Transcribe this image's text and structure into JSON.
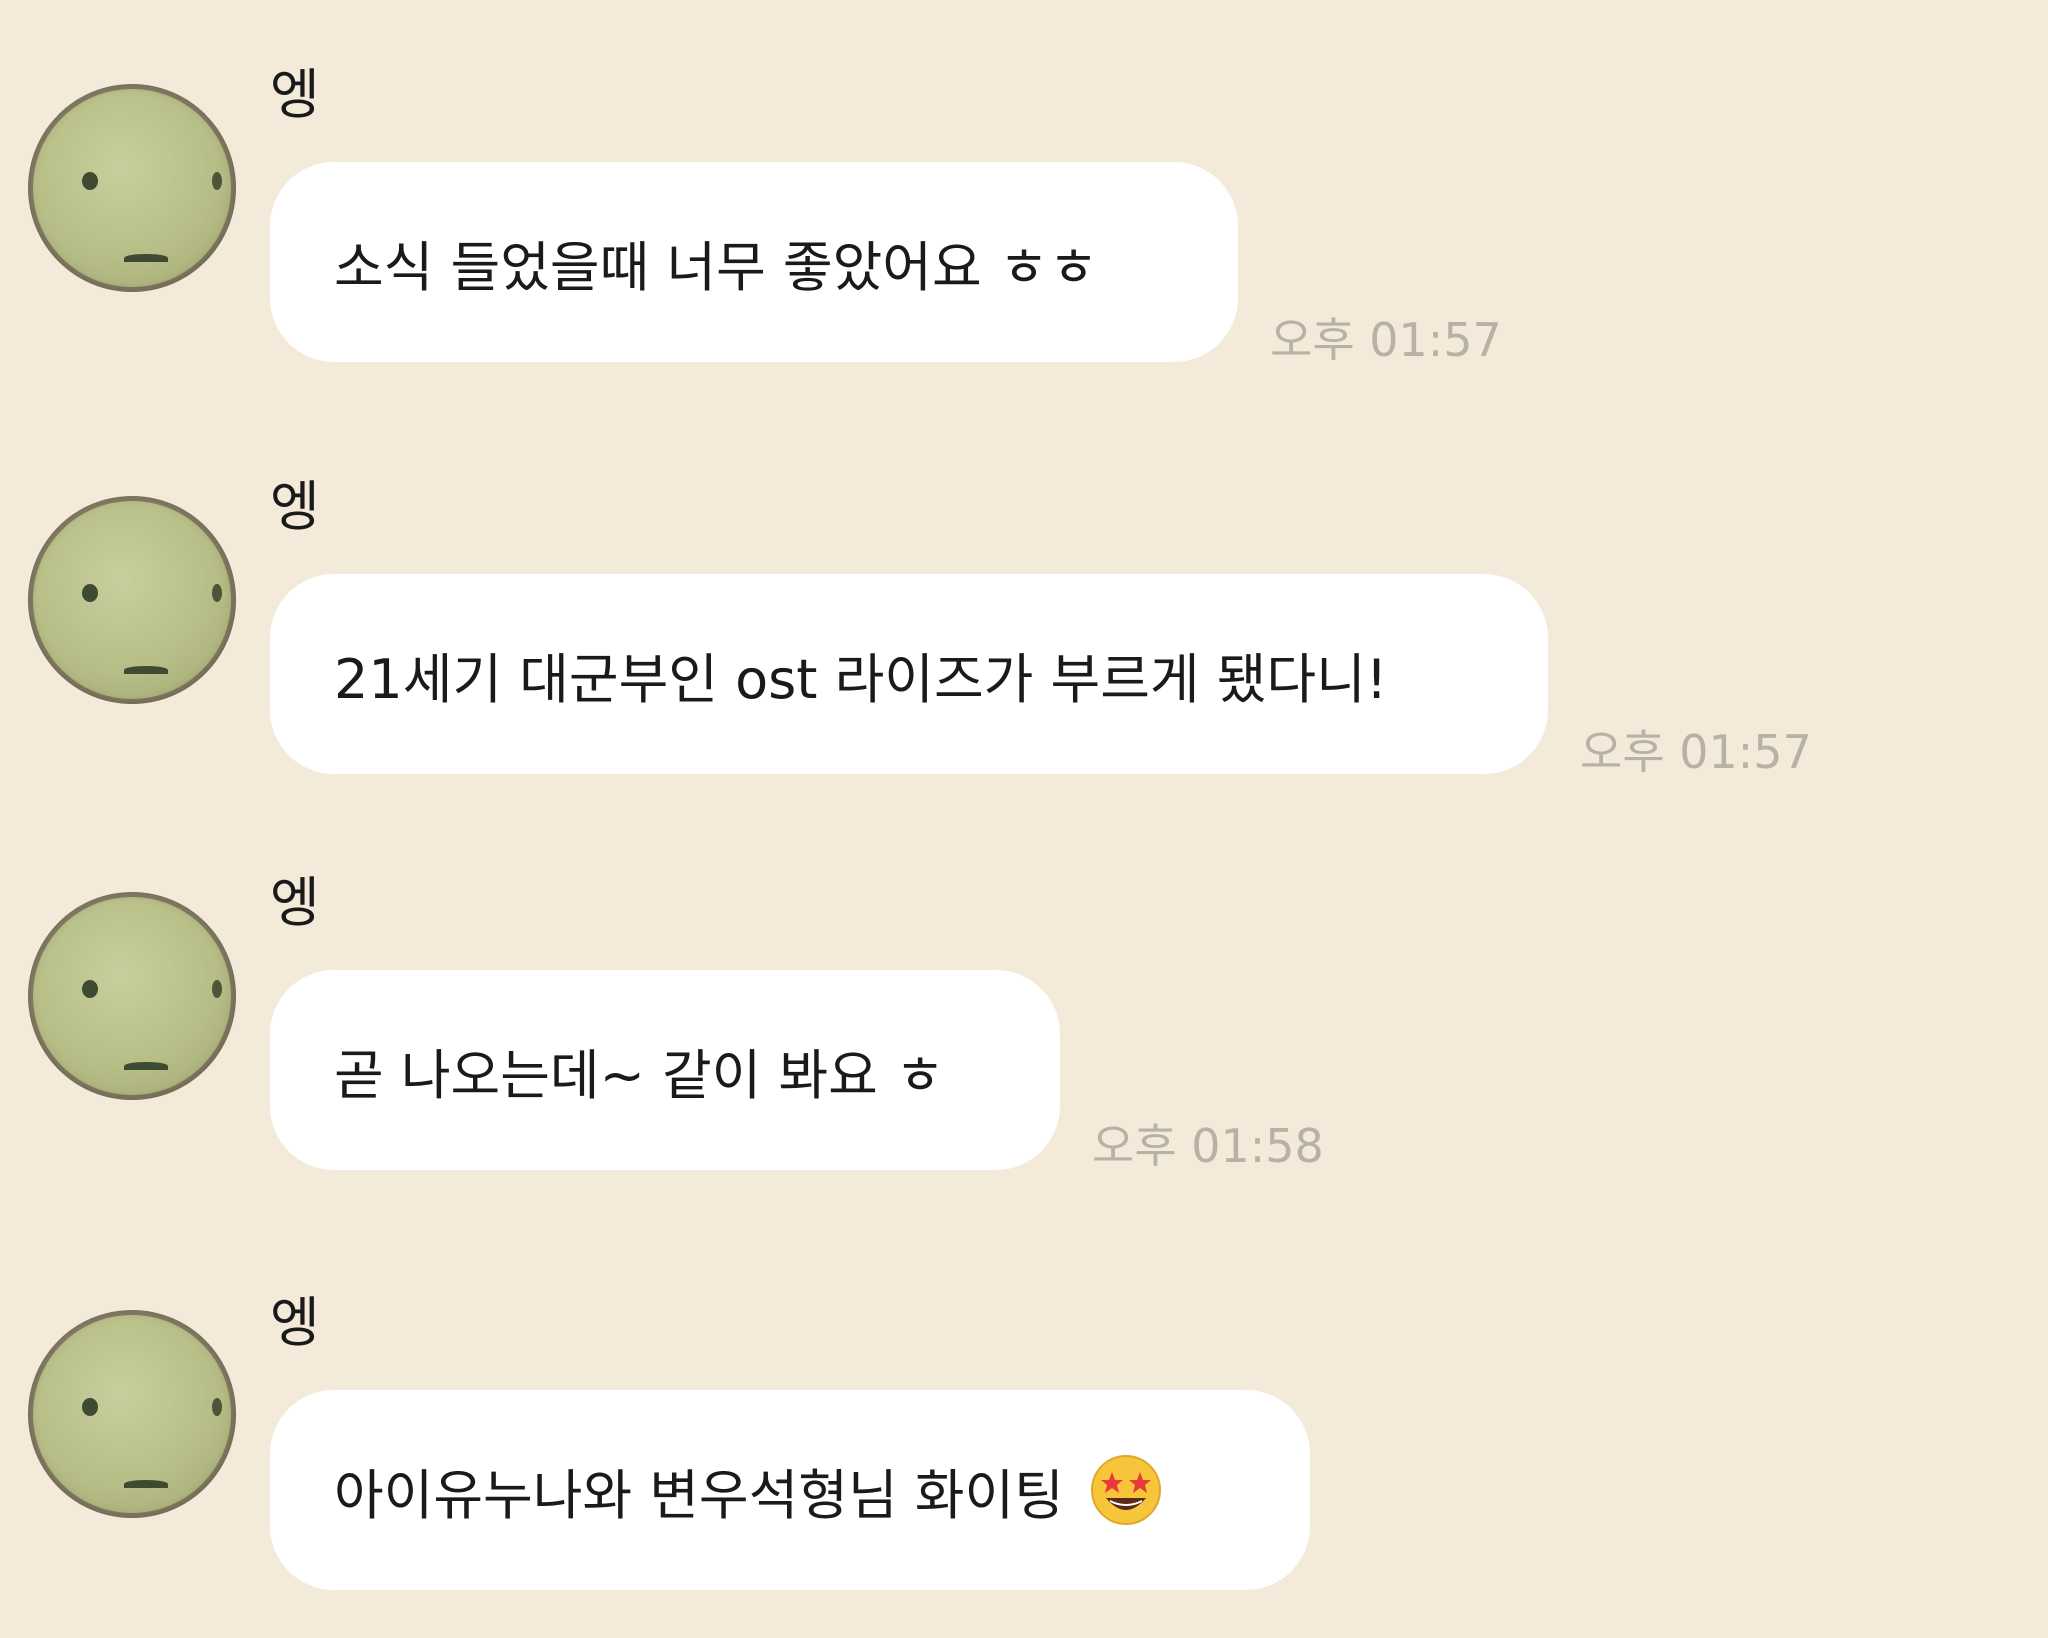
{
  "chat": {
    "messages": [
      {
        "sender": "엥",
        "text": "소식 들었을때 너무 좋았어요 ㅎㅎ",
        "time": "오후 01:57"
      },
      {
        "sender": "엥",
        "text": "21세기 대군부인 ost 라이즈가 부르게 됐다니!",
        "time": "오후 01:57"
      },
      {
        "sender": "엥",
        "text": "곧 나오는데~ 같이 봐요 ㅎ",
        "time": "오후 01:58"
      },
      {
        "sender": "엥",
        "text": "아이유누나와 변우석형님 화이팅",
        "emoji": "star-struck-emoji"
      }
    ]
  },
  "colors": {
    "background": "#f3ead9",
    "bubble": "#ffffff",
    "timestamp": "#b8b2a6",
    "text": "#1a1a1a"
  }
}
